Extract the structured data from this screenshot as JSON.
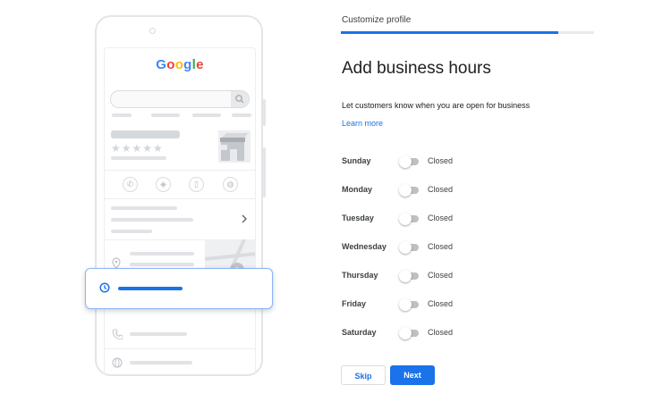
{
  "preview": {
    "logo_letters": [
      {
        "ch": "G",
        "color": "#4285f4"
      },
      {
        "ch": "o",
        "color": "#ea4335"
      },
      {
        "ch": "o",
        "color": "#fbbc05"
      },
      {
        "ch": "g",
        "color": "#4285f4"
      },
      {
        "ch": "l",
        "color": "#34a853"
      },
      {
        "ch": "e",
        "color": "#ea4335"
      }
    ],
    "rating_stars": "★★★★★"
  },
  "header": {
    "step_label": "Customize profile",
    "progress": 0.86
  },
  "main": {
    "title": "Add business hours",
    "description": "Let customers know when you are open for business",
    "learn_more": "Learn more",
    "days": [
      {
        "name": "Sunday",
        "status": "Closed"
      },
      {
        "name": "Monday",
        "status": "Closed"
      },
      {
        "name": "Tuesday",
        "status": "Closed"
      },
      {
        "name": "Wednesday",
        "status": "Closed"
      },
      {
        "name": "Thursday",
        "status": "Closed"
      },
      {
        "name": "Friday",
        "status": "Closed"
      },
      {
        "name": "Saturday",
        "status": "Closed"
      }
    ]
  },
  "actions": {
    "skip_label": "Skip",
    "next_label": "Next"
  },
  "colors": {
    "accent": "#1a73e8",
    "toggle_off": "#bdc1c6"
  }
}
